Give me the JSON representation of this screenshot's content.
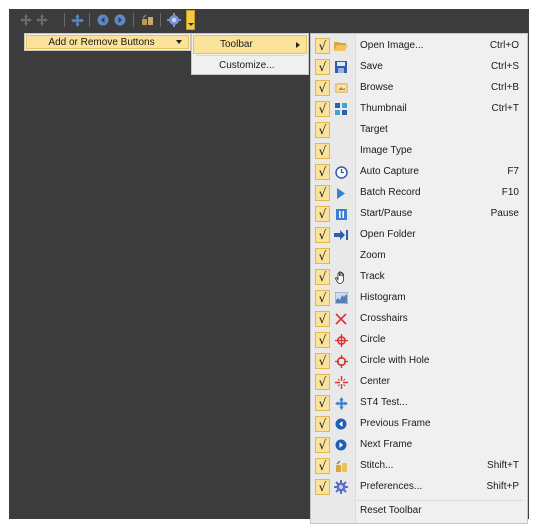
{
  "toolbar_icons": [
    "move-left-icon",
    "move-right-icon",
    "crosshair-move-icon",
    "previous-frame-icon",
    "next-frame-icon",
    "stitch-icon",
    "preferences-icon"
  ],
  "context_menu": {
    "label": "Add or Remove Buttons"
  },
  "submenu": {
    "items": [
      {
        "label": "Toolbar"
      },
      {
        "label": "Customize..."
      }
    ]
  },
  "buttons_menu": {
    "items": [
      {
        "label": "Open Image...",
        "shortcut": "Ctrl+O",
        "icon": "folder-open-icon",
        "checked": true
      },
      {
        "label": "Save",
        "shortcut": "Ctrl+S",
        "icon": "floppy-disk-icon",
        "checked": true
      },
      {
        "label": "Browse",
        "shortcut": "Ctrl+B",
        "icon": "browse-image-icon",
        "checked": true
      },
      {
        "label": "Thumbnail",
        "shortcut": "Ctrl+T",
        "icon": "thumbnail-grid-icon",
        "checked": true
      },
      {
        "label": "Target",
        "shortcut": "",
        "icon": "",
        "checked": true
      },
      {
        "label": "Image Type",
        "shortcut": "",
        "icon": "",
        "checked": true
      },
      {
        "label": "Auto Capture",
        "shortcut": "F7",
        "icon": "clock-icon",
        "checked": true
      },
      {
        "label": "Batch Record",
        "shortcut": "F10",
        "icon": "play-icon",
        "checked": true
      },
      {
        "label": "Start/Pause",
        "shortcut": "Pause",
        "icon": "pause-icon",
        "checked": true
      },
      {
        "label": "Open Folder",
        "shortcut": "",
        "icon": "arrow-into-folder-icon",
        "checked": true
      },
      {
        "label": "Zoom",
        "shortcut": "",
        "icon": "",
        "checked": true
      },
      {
        "label": "Track",
        "shortcut": "",
        "icon": "hand-icon",
        "checked": true
      },
      {
        "label": "Histogram",
        "shortcut": "",
        "icon": "histogram-icon",
        "checked": true
      },
      {
        "label": "Crosshairs",
        "shortcut": "",
        "icon": "crosshairs-x-icon",
        "checked": true
      },
      {
        "label": "Circle",
        "shortcut": "",
        "icon": "circle-target-icon",
        "checked": true
      },
      {
        "label": "Circle with Hole",
        "shortcut": "",
        "icon": "circle-hole-target-icon",
        "checked": true
      },
      {
        "label": "Center",
        "shortcut": "",
        "icon": "center-cross-icon",
        "checked": true
      },
      {
        "label": "ST4 Test...",
        "shortcut": "",
        "icon": "st4-test-icon",
        "checked": true
      },
      {
        "label": "Previous Frame",
        "shortcut": "",
        "icon": "previous-frame-icon",
        "checked": true
      },
      {
        "label": "Next Frame",
        "shortcut": "",
        "icon": "next-frame-icon",
        "checked": true
      },
      {
        "label": "Stitch...",
        "shortcut": "Shift+T",
        "icon": "stitch-icon",
        "checked": true
      },
      {
        "label": "Preferences...",
        "shortcut": "Shift+P",
        "icon": "gear-icon",
        "checked": true
      }
    ],
    "check_mark": "√",
    "reset_label": "Reset Toolbar"
  },
  "colors": {
    "highlight": "#fbe29a",
    "menu_bg": "#f0f0f0",
    "workspace": "#3c3c3c",
    "accent_blue": "#1f5fb8",
    "accent_red": "#e03030"
  }
}
